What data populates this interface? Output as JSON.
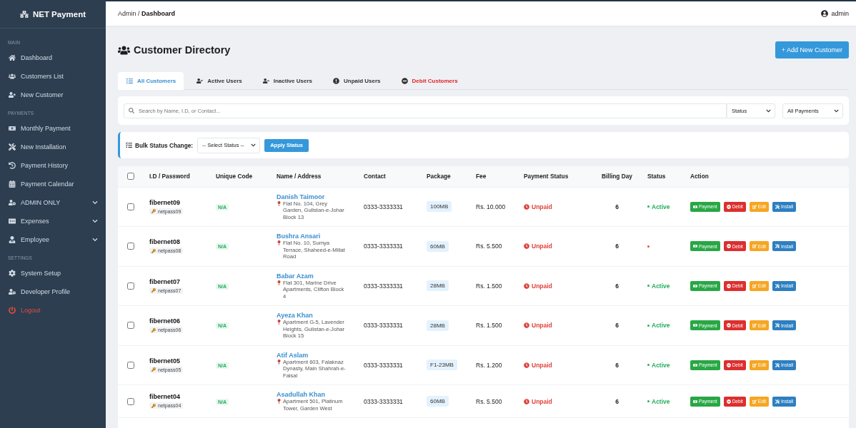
{
  "brand": {
    "name": "NET Payment"
  },
  "sidebar": {
    "sections": [
      {
        "heading": "MAIN",
        "items": [
          {
            "label": "Dashboard",
            "kind": "link"
          },
          {
            "label": "Customers List",
            "kind": "link"
          },
          {
            "label": "New Customer",
            "kind": "link"
          }
        ]
      },
      {
        "heading": "PAYMENTS",
        "items": [
          {
            "label": "Monthly Payment",
            "kind": "link"
          },
          {
            "label": "New Installation",
            "kind": "link"
          },
          {
            "label": "Payment History",
            "kind": "link"
          },
          {
            "label": "Payment Calendar",
            "kind": "link"
          },
          {
            "label": "ADMIN ONLY",
            "kind": "dropdown"
          },
          {
            "label": "Expenses",
            "kind": "dropdown"
          },
          {
            "label": "Employee",
            "kind": "dropdown"
          }
        ]
      },
      {
        "heading": "SETTINGS",
        "items": [
          {
            "label": "System Setup",
            "kind": "link"
          },
          {
            "label": "Developer Profile",
            "kind": "link"
          },
          {
            "label": "Logout",
            "kind": "logout"
          }
        ]
      }
    ]
  },
  "header": {
    "breadcrumb": "Admin / **Dashboard**",
    "user": "admin"
  },
  "page": {
    "title": "Customer Directory",
    "add_button": "+ Add New Customer"
  },
  "tabs": [
    {
      "label": "All Customers",
      "selected": true,
      "kind": "normal"
    },
    {
      "label": "Active Users",
      "selected": false,
      "kind": "normal"
    },
    {
      "label": "Inactive Users",
      "selected": false,
      "kind": "normal"
    },
    {
      "label": "Unpaid Users",
      "selected": false,
      "kind": "normal"
    },
    {
      "label": "Debit Customers",
      "selected": false,
      "kind": "danger"
    }
  ],
  "filters": {
    "search": {
      "placeholder": "Search by Name, I.D, or Contact..."
    },
    "status_select": "Status",
    "payment_select": "All Payments"
  },
  "bulk": {
    "label": "Bulk Status Change:",
    "select": "-- Select Status --",
    "button": "Apply Status"
  },
  "table": {
    "select_all": {
      "checked": false
    },
    "columns": [
      "I.D / Password",
      "Unique Code",
      "Name / Address",
      "Contact",
      "Package",
      "Fee",
      "Payment Status",
      "Billing Day",
      "Status",
      "Action"
    ],
    "rows": [
      {
        "checked": false,
        "id": "fibernet09",
        "password": "netpass09",
        "unique_code": "N/A",
        "name": "Danish Taimoor",
        "address": "Flat No. 104, Grey Garden, Gulistan-e-Johar Block 13",
        "contact": "0333-3333331",
        "package": "100MB",
        "fee": "Rs. 10.000",
        "payment_status": {
          "kind": "unpaid",
          "label": "Unpaid"
        },
        "billing_day": "6",
        "status": {
          "active": true,
          "label": "Active"
        },
        "actions": [
          {
            "kind": "payment",
            "label": "Payment"
          },
          {
            "kind": "debit",
            "label": "Debit"
          },
          {
            "kind": "edit",
            "label": "Edit"
          },
          {
            "kind": "install",
            "label": "Install"
          }
        ]
      },
      {
        "checked": false,
        "id": "fibernet08",
        "password": "netpass08",
        "unique_code": "N/A",
        "name": "Bushra Ansari",
        "address": "Flat No. 10, Sumya Terrace, Shaheed-e-Millat Road",
        "contact": "0333-3333331",
        "package": "60MB",
        "fee": "Rs. 5.500",
        "payment_status": {
          "kind": "unpaid",
          "label": "Unpaid"
        },
        "billing_day": "6",
        "status": {
          "active": false
        },
        "actions": [
          {
            "kind": "payment",
            "label": "Payment"
          },
          {
            "kind": "debit",
            "label": "Debit"
          },
          {
            "kind": "edit",
            "label": "Edit"
          },
          {
            "kind": "install",
            "label": "Install"
          }
        ]
      },
      {
        "checked": false,
        "id": "fibernet07",
        "password": "netpass07",
        "unique_code": "N/A",
        "name": "Babar Azam",
        "address": "Flat 301, Marine Drive Apartments, Clifton Block 4",
        "contact": "0333-3333331",
        "package": "28MB",
        "fee": "Rs. 1.500",
        "payment_status": {
          "kind": "unpaid",
          "label": "Unpaid"
        },
        "billing_day": "6",
        "status": {
          "active": true,
          "label": "Active"
        },
        "actions": [
          {
            "kind": "payment",
            "label": "Payment"
          },
          {
            "kind": "debit",
            "label": "Debit"
          },
          {
            "kind": "edit",
            "label": "Edit"
          },
          {
            "kind": "install",
            "label": "Install"
          }
        ]
      },
      {
        "checked": false,
        "id": "fibernet06",
        "password": "netpass06",
        "unique_code": "N/A",
        "name": "Ayeza Khan",
        "address": "Apartment G-5, Lavender Heights, Gulistan-e-Johar Block 15",
        "contact": "0333-3333331",
        "package": "28MB",
        "fee": "Rs. 1.500",
        "payment_status": {
          "kind": "unpaid",
          "label": "Unpaid"
        },
        "billing_day": "6",
        "status": {
          "active": true,
          "label": "Active"
        },
        "actions": [
          {
            "kind": "payment",
            "label": "Payment"
          },
          {
            "kind": "debit",
            "label": "Debit"
          },
          {
            "kind": "edit",
            "label": "Edit"
          },
          {
            "kind": "install",
            "label": "Install"
          }
        ]
      },
      {
        "checked": false,
        "id": "fibernet05",
        "password": "netpass05",
        "unique_code": "N/A",
        "name": "Atif Aslam",
        "address": "Apartment 603, Falaknaz Dynasty, Main Shahrah-e-Faisal",
        "contact": "0333-3333331",
        "package": "F1-23MB",
        "fee": "Rs. 1.200",
        "payment_status": {
          "kind": "unpaid",
          "label": "Unpaid"
        },
        "billing_day": "6",
        "status": {
          "active": true,
          "label": "Active"
        },
        "actions": [
          {
            "kind": "payment",
            "label": "Payment"
          },
          {
            "kind": "debit",
            "label": "Debit"
          },
          {
            "kind": "edit",
            "label": "Edit"
          },
          {
            "kind": "install",
            "label": "Install"
          }
        ]
      },
      {
        "checked": false,
        "id": "fibernet04",
        "password": "netpass04",
        "unique_code": "N/A",
        "name": "Asadullah Khan",
        "address": "Apartment 501, Platinum Tower, Garden West",
        "contact": "0333-3333331",
        "package": "60MB",
        "fee": "Rs. 5.500",
        "payment_status": {
          "kind": "unpaid",
          "label": "Unpaid"
        },
        "billing_day": "6",
        "status": {
          "active": true,
          "label": "Active"
        },
        "actions": [
          {
            "kind": "payment",
            "label": "Payment"
          },
          {
            "kind": "debit",
            "label": "Debit"
          },
          {
            "kind": "edit",
            "label": "Edit"
          },
          {
            "kind": "install",
            "label": "Install"
          }
        ]
      }
    ]
  }
}
